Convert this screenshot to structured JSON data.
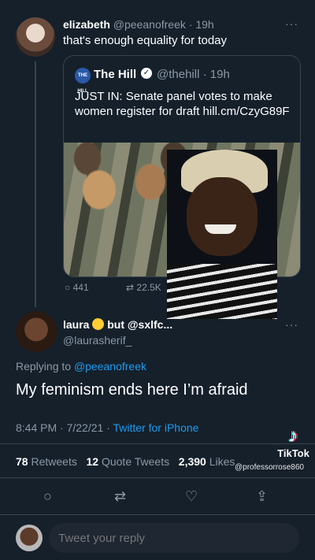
{
  "top_tweet": {
    "name": "elizabeth",
    "handle": "@peeanofreek",
    "time": "19h",
    "text": "that's enough equality for today",
    "more": "···"
  },
  "quoted_tweet": {
    "logo_text": "THE HILL",
    "name": "The Hill",
    "verified_icon": "✓",
    "handle": "@thehill",
    "time": "19h",
    "text": "JUST IN: Senate panel votes to make women register for draft hill.cm/CzyG89F",
    "reply_count": "441",
    "retweet_count": "22.5K"
  },
  "reply_tweet": {
    "name": "laura",
    "name_suffix": "but @sxlfc...",
    "handle": "@laurasherif_",
    "more": "···",
    "replying_label": "Replying to",
    "replying_handle": "@peeanofreek",
    "text": "My feminism ends here I’m afraid",
    "time": "8:44 PM",
    "date": "7/22/21",
    "source": "Twitter for iPhone"
  },
  "stats": {
    "retweets_count": "78",
    "retweets_label": "Retweets",
    "quotes_count": "12",
    "quotes_label": "Quote Tweets",
    "likes_count": "2,390",
    "likes_label": "Likes"
  },
  "watermark": {
    "brand": "TikTok",
    "user": "@professorrose860"
  },
  "actions": {
    "reply_icon": "○",
    "retweet_icon": "⇄",
    "like_icon": "♡",
    "share_icon": "⇪"
  },
  "reply_box": {
    "placeholder": "Tweet your reply"
  },
  "colors": {
    "background": "#15202b",
    "accent": "#1d9bf0",
    "muted": "#8b98a5"
  }
}
